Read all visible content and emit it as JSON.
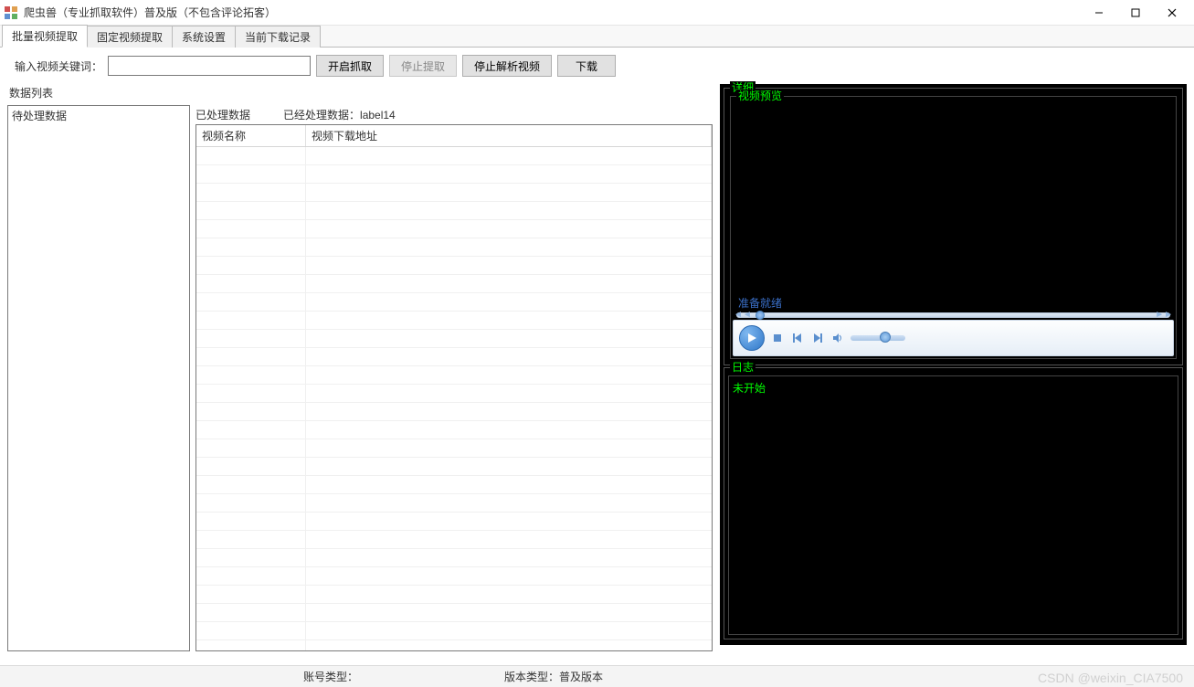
{
  "window": {
    "title": "爬虫兽（专业抓取软件）普及版（不包含评论拓客）"
  },
  "tabs": [
    "批量视频提取",
    "固定视频提取",
    "系统设置",
    "当前下载记录"
  ],
  "search": {
    "label": "输入视频关键词：",
    "value": "",
    "btn_start": "开启抓取",
    "btn_stop": "停止提取",
    "btn_stop_parse": "停止解析视频",
    "btn_download": "下载"
  },
  "data_list": {
    "title": "数据列表",
    "pending_header": "待处理数据",
    "processed_header": "已处理数据",
    "processed_count_label": "已经处理数据：",
    "processed_count_value": "label14",
    "grid_headers": {
      "name": "视频名称",
      "url": "视频下载地址"
    }
  },
  "detail": {
    "title": "详细",
    "preview_title": "视频预览",
    "status": "准备就绪"
  },
  "log": {
    "title": "日志",
    "content": "未开始"
  },
  "statusbar": {
    "account_type_label": "账号类型：",
    "account_type_value": "",
    "version_type_label": "版本类型：",
    "version_type_value": "普及版本"
  },
  "watermark": "CSDN @weixin_CIA7500"
}
